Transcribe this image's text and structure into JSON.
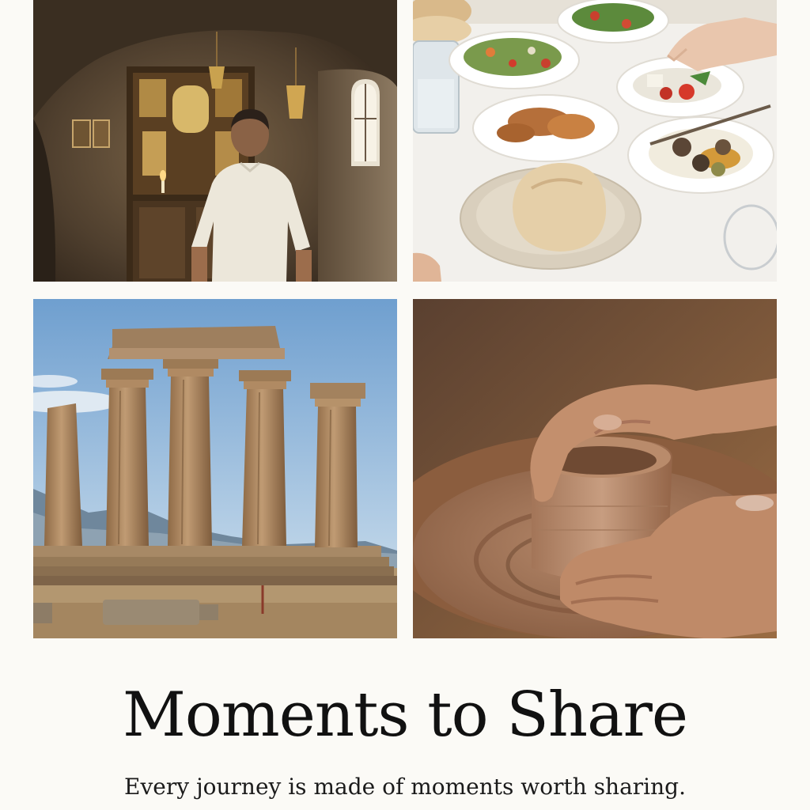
{
  "page": {
    "background": "#fbfaf6"
  },
  "gallery": {
    "photos": [
      {
        "subject": "chapel",
        "icon": "chapel-photo-icon"
      },
      {
        "subject": "meal",
        "icon": "meal-photo-icon"
      },
      {
        "subject": "temple",
        "icon": "temple-photo-icon"
      },
      {
        "subject": "pottery",
        "icon": "pottery-photo-icon"
      }
    ]
  },
  "content": {
    "title": "Moments to Share",
    "subtitle": "Every journey is made of moments worth sharing."
  },
  "colors": {
    "text": "#111111",
    "stone": "#b08a63",
    "sky": "#8fb5da",
    "clay": "#b98b6b"
  }
}
